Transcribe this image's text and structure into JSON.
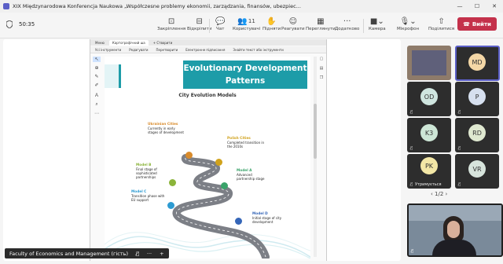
{
  "window": {
    "title": "XIX Międzynarodowa Konferencja Naukowa „Współczesne problemy ekonomii, zarządzania, finansów, ubezpiec...",
    "controls": [
      "—",
      "☐",
      "✕"
    ]
  },
  "meeting": {
    "timer": "50:35",
    "leave_label": "Вийти",
    "toolbar": [
      {
        "label": "Закріплення",
        "icon": "pin-icon"
      },
      {
        "label": "Відкріпити",
        "icon": "unpin-icon"
      },
      {
        "label": "Чат",
        "icon": "chat-icon"
      },
      {
        "label": "Користувачі",
        "icon": "people-icon",
        "count": "11"
      },
      {
        "label": "Підняти",
        "icon": "raise-hand-icon"
      },
      {
        "label": "Реагувати",
        "icon": "react-icon"
      },
      {
        "label": "Переглянути",
        "icon": "view-icon"
      },
      {
        "label": "Додатково",
        "icon": "more-icon"
      },
      {
        "label": "Камера",
        "icon": "camera-icon"
      },
      {
        "label": "Мікрофон",
        "icon": "mic-icon"
      },
      {
        "label": "Поділитися",
        "icon": "share-icon"
      }
    ]
  },
  "shared_screen": {
    "browser_tabs": [
      "Меню",
      "Картографічний ша",
      "+ Створити"
    ],
    "pdf_menu": [
      "Усі інструменти",
      "Редагувати",
      "Перетворити",
      "Електронне підписання",
      "Знайти текст або інструменти"
    ],
    "slide": {
      "title_line1": "Evolutionary Development",
      "title_line2": "Patterns",
      "subtitle": "City Evolution Models",
      "labels": [
        {
          "head": "Ukrainian Cities",
          "text": "Currently in early stages of development",
          "color": "#d98b2b"
        },
        {
          "head": "Polish Cities",
          "text": "Completed transition in the 2010s",
          "color": "#d0a21c"
        },
        {
          "head": "Model B",
          "text": "Final stage of sophisticated partnerships",
          "color": "#8bb43a"
        },
        {
          "head": "Model A",
          "text": "Advanced partnership stage",
          "color": "#3aa36a"
        },
        {
          "head": "Model C",
          "text": "Transition phase with EU support",
          "color": "#2d9bd2"
        },
        {
          "head": "Model D",
          "text": "Initial stage of city development",
          "color": "#3566b8"
        }
      ]
    }
  },
  "participants": [
    {
      "initials": "",
      "name": "",
      "muted": false,
      "video": true,
      "color": "#8e7b6a"
    },
    {
      "initials": "MD",
      "name": "",
      "muted": false,
      "color": "#f4d7a6"
    },
    {
      "initials": "OD",
      "name": "",
      "muted": true,
      "color": "#cfe5df"
    },
    {
      "initials": "P",
      "name": "",
      "muted": true,
      "color": "#d6e0ef"
    },
    {
      "initials": "K3",
      "name": "",
      "muted": true,
      "color": "#cde6d6"
    },
    {
      "initials": "RD",
      "name": "",
      "muted": true,
      "color": "#dfe8d0"
    },
    {
      "initials": "PK",
      "name": "Утримується",
      "muted": true,
      "color": "#f3e7a6"
    },
    {
      "initials": "VR",
      "name": "",
      "muted": true,
      "color": "#d7e4dc"
    }
  ],
  "pager": "1/2",
  "presenter_name": "Faculty of Economics and Management (гість)"
}
